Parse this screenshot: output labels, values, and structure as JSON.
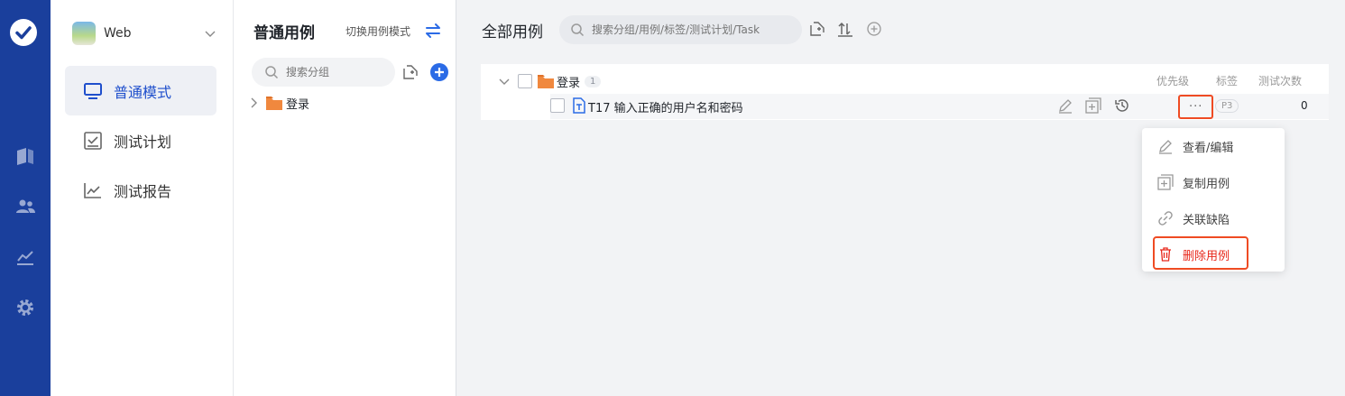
{
  "project": {
    "name": "Web"
  },
  "nav": {
    "items": [
      {
        "label": "普通模式",
        "icon": "monitor-icon",
        "active": true
      },
      {
        "label": "测试计划",
        "icon": "checklist-icon",
        "active": false
      },
      {
        "label": "测试报告",
        "icon": "trend-chart-icon",
        "active": false
      }
    ]
  },
  "tree": {
    "title": "普通用例",
    "mode_switch": "切换用例模式",
    "search_placeholder": "搜索分组",
    "root_folder": "登录"
  },
  "main": {
    "title": "全部用例",
    "search_placeholder": "搜索分组/用例/标签/测试计划/Task",
    "columns": {
      "priority": "优先级",
      "tags": "标签",
      "runs": "测试次数"
    },
    "folder": {
      "name": "登录",
      "count": "1"
    },
    "case": {
      "name": "T17 输入正确的用户名和密码",
      "priority": "P3",
      "runs": "0"
    }
  },
  "menu": {
    "items": [
      {
        "label": "查看/编辑",
        "icon": "pencil-icon"
      },
      {
        "label": "复制用例",
        "icon": "copy-icon"
      },
      {
        "label": "关联缺陷",
        "icon": "link-icon"
      },
      {
        "label": "删除用例",
        "icon": "trash-icon"
      }
    ]
  },
  "colors": {
    "brand": "#1a3f9c",
    "accent": "#2b6be6",
    "danger": "#e8291c",
    "highlight": "#ef4b23",
    "folder": "#f0883e"
  }
}
